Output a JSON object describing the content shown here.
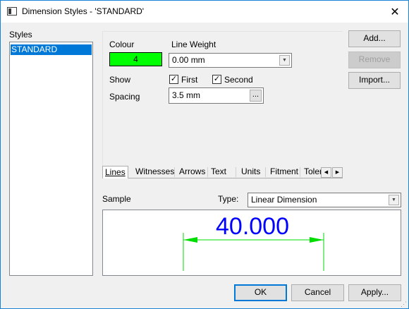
{
  "window": {
    "title": "Dimension Styles - 'STANDARD'",
    "close_glyph": "✕"
  },
  "styles": {
    "label": "Styles",
    "items": [
      "STANDARD"
    ]
  },
  "fields": {
    "colour_label": "Colour",
    "colour_value": "4",
    "colour_swatch": "#00ff00",
    "line_weight_label": "Line Weight",
    "line_weight_value": "0.00 mm",
    "show_label": "Show",
    "first_label": "First",
    "first_checked": true,
    "second_label": "Second",
    "second_checked": true,
    "spacing_label": "Spacing",
    "spacing_value": "3.5 mm",
    "ellipsis": "..."
  },
  "side_buttons": {
    "add": "Add...",
    "remove": "Remove",
    "import": "Import..."
  },
  "tabs": [
    "Lines",
    "Witnesses",
    "Arrows",
    "Text",
    "Units",
    "Fitment",
    "Toler"
  ],
  "sample": {
    "label": "Sample",
    "type_label": "Type:",
    "type_value": "Linear Dimension",
    "dimension_text": "40.000",
    "dimension_color": "#0000ff",
    "line_color": "#00dd00"
  },
  "footer": {
    "ok": "OK",
    "cancel": "Cancel",
    "apply": "Apply..."
  }
}
